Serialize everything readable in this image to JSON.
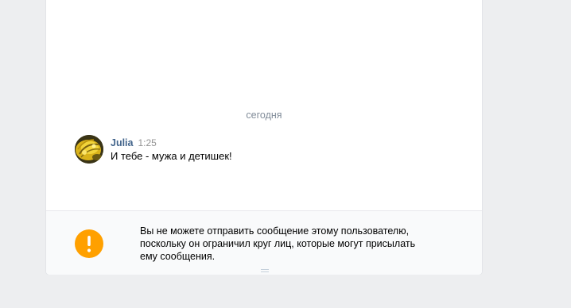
{
  "history": {
    "date_divider": "сегодня"
  },
  "message": {
    "author": "Julia",
    "time": "1:25",
    "text": "И тебе - мужа и детишек!",
    "avatar_icon": "user-avatar"
  },
  "notice": {
    "icon": "exclamation-icon",
    "icon_color": "#ffa000",
    "lines": [
      "Вы не можете отправить сообщение этому пользователю,",
      "поскольку он ограничил круг лиц, которые могут присылать",
      "ему сообщения."
    ]
  },
  "colors": {
    "background": "#edeef0",
    "author_link": "#42648b",
    "muted_text": "#818c99"
  }
}
